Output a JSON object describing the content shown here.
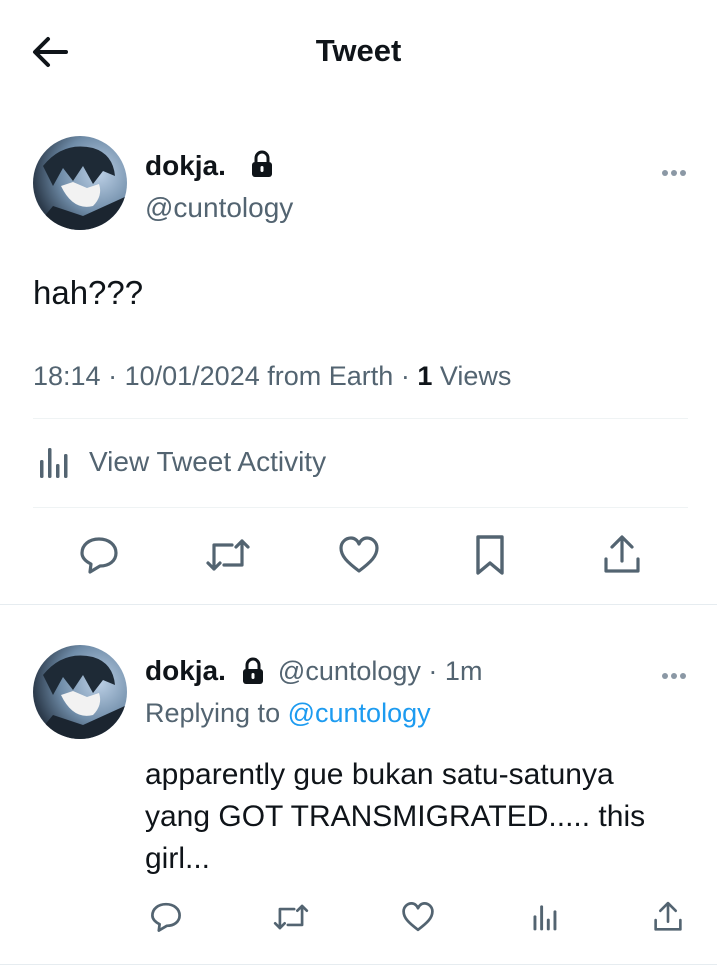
{
  "header": {
    "title": "Tweet"
  },
  "tweet": {
    "author_name": "dokja.",
    "author_handle": "@cuntology",
    "text": "hah???",
    "time": "18:14",
    "date": "10/01/2024",
    "source": "from Earth",
    "views_count": "1",
    "views_label": "Views",
    "activity_label": "View Tweet Activity"
  },
  "reply": {
    "author_name": "dokja.",
    "author_handle": "@cuntology",
    "age": "1m",
    "replying_to_label": "Replying to",
    "replying_to_handle": "@cuntology",
    "text_line1": "apparently gue bukan satu-satunya",
    "text_line2": "yang GOT TRANSMIGRATED..... this",
    "text_line3": "girl..."
  },
  "colors": {
    "accent": "#1d9bf0",
    "icon": "#536471",
    "text": "#0f1419"
  }
}
